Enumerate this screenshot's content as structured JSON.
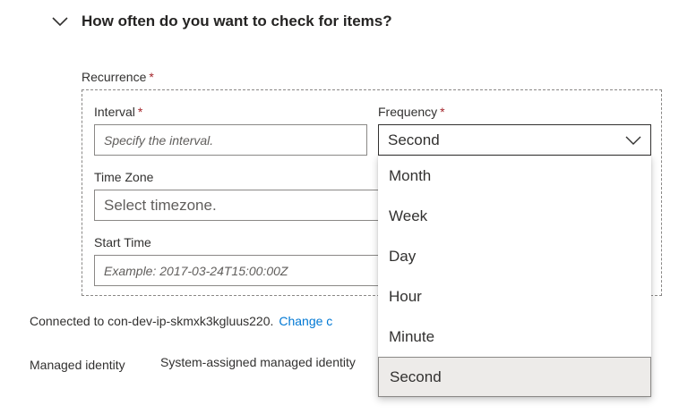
{
  "section": {
    "title": "How often do you want to check for items?",
    "chevron_icon": "chevron-down-icon"
  },
  "recurrence": {
    "label": "Recurrence",
    "required_mark": "*",
    "interval": {
      "label": "Interval",
      "required_mark": "*",
      "placeholder": "Specify the interval."
    },
    "frequency": {
      "label": "Frequency",
      "required_mark": "*",
      "value": "Second",
      "caret_icon": "chevron-down-icon"
    },
    "time_zone": {
      "label": "Time Zone",
      "placeholder": "Select timezone."
    },
    "start_time": {
      "label": "Start Time",
      "placeholder": "Example: 2017-03-24T15:00:00Z"
    }
  },
  "connection": {
    "text": "Connected to con-dev-ip-skmxk3kgluus220.",
    "change_link": "Change c"
  },
  "managed_identity": {
    "label": "Managed identity",
    "value": "System-assigned managed identity"
  },
  "frequency_options": [
    {
      "label": "Month",
      "selected": false
    },
    {
      "label": "Week",
      "selected": false
    },
    {
      "label": "Day",
      "selected": false
    },
    {
      "label": "Hour",
      "selected": false
    },
    {
      "label": "Minute",
      "selected": false
    },
    {
      "label": "Second",
      "selected": true
    }
  ],
  "colors": {
    "link": "#0078d4",
    "required": "#a4262c",
    "selected_bg": "#edebe9",
    "border": "#8a8886"
  }
}
